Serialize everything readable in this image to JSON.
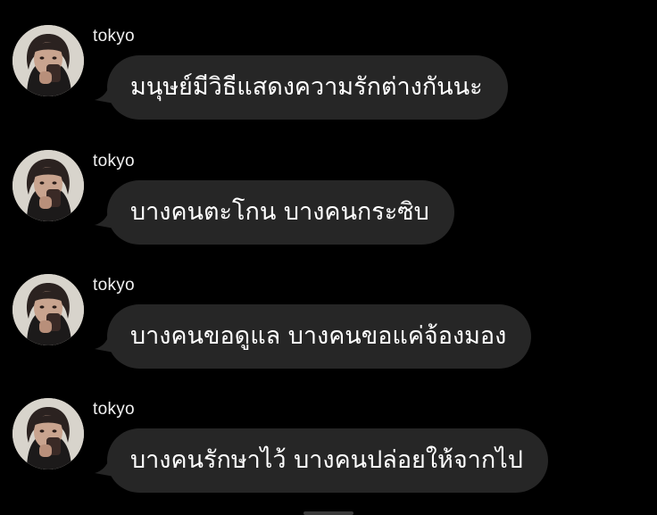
{
  "theme": {
    "background": "#000000",
    "bubble": "#262626",
    "text": "#ffffff"
  },
  "messages": [
    {
      "username": "tokyo",
      "avatar": "profile-photo",
      "text": "มนุษย์มีวิธีแสดงความรักต่างกันนะ"
    },
    {
      "username": "tokyo",
      "avatar": "profile-photo",
      "text": "บางคนตะโกน บางคนกระซิบ"
    },
    {
      "username": "tokyo",
      "avatar": "profile-photo",
      "text": "บางคนขอดูแล บางคนขอแค่จ้องมอง"
    },
    {
      "username": "tokyo",
      "avatar": "profile-photo",
      "text": "บางคนรักษาไว้ บางคนปล่อยให้จากไป"
    }
  ]
}
